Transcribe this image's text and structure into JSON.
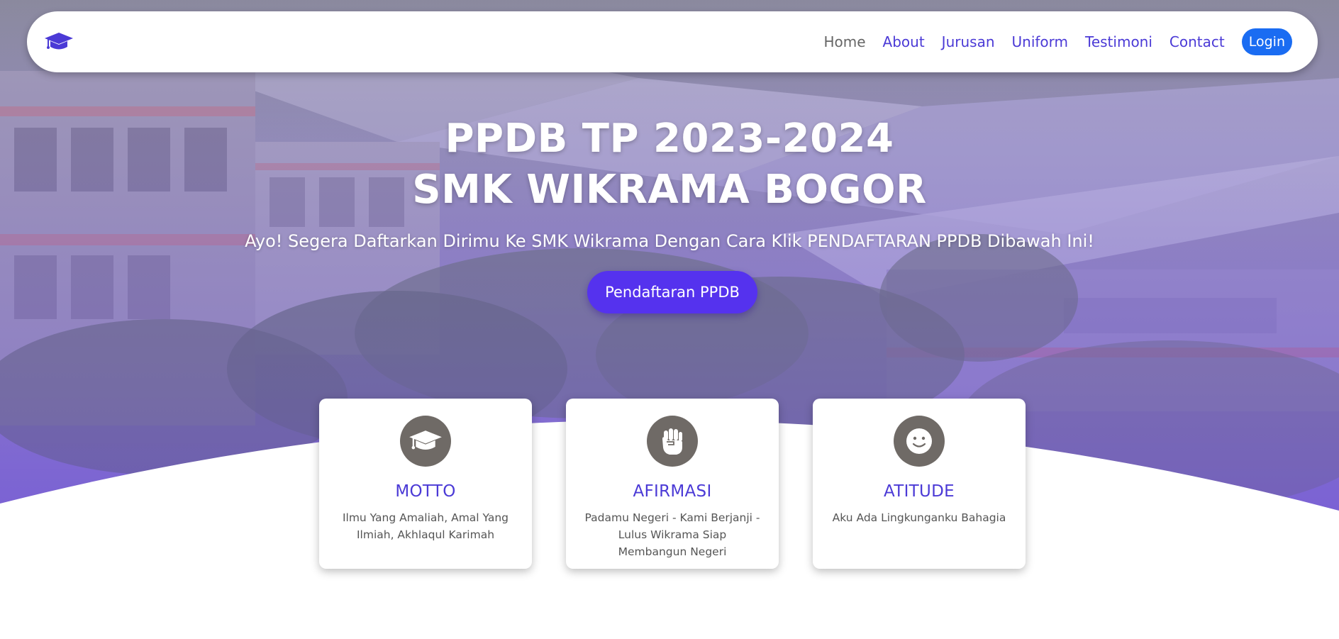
{
  "navbar": {
    "logo_icon": "graduation-cap-icon",
    "links": [
      {
        "label": "Home",
        "active": true
      },
      {
        "label": "About",
        "active": false
      },
      {
        "label": "Jurusan",
        "active": false
      },
      {
        "label": "Uniform",
        "active": false
      },
      {
        "label": "Testimoni",
        "active": false
      },
      {
        "label": "Contact",
        "active": false
      }
    ],
    "login_label": "Login"
  },
  "hero": {
    "title_line1": "PPDB TP 2023-2024",
    "title_line2": "SMK WIKRAMA BOGOR",
    "subtitle": "Ayo! Segera Daftarkan Dirimu Ke SMK Wikrama Dengan Cara Klik PENDAFTARAN PPDB Dibawah Ini!",
    "cta_label": "Pendaftaran PPDB"
  },
  "cards": [
    {
      "icon": "graduation-cap-icon",
      "title": "MOTTO",
      "text": "Ilmu Yang Amaliah, Amal Yang Ilmiah, Akhlaqul Karimah"
    },
    {
      "icon": "fist-icon",
      "title": "AFIRMASI",
      "text": "Padamu Negeri - Kami Berjanji - Lulus Wikrama Siap Membangun Negeri"
    },
    {
      "icon": "smile-icon",
      "title": "ATITUDE",
      "text": "Aku Ada Lingkunganku Bahagia"
    }
  ],
  "colors": {
    "accent": "#4b3ad6",
    "cta": "#5532ee",
    "login": "#1a6cf2",
    "icon_bg": "#6f6a66"
  }
}
